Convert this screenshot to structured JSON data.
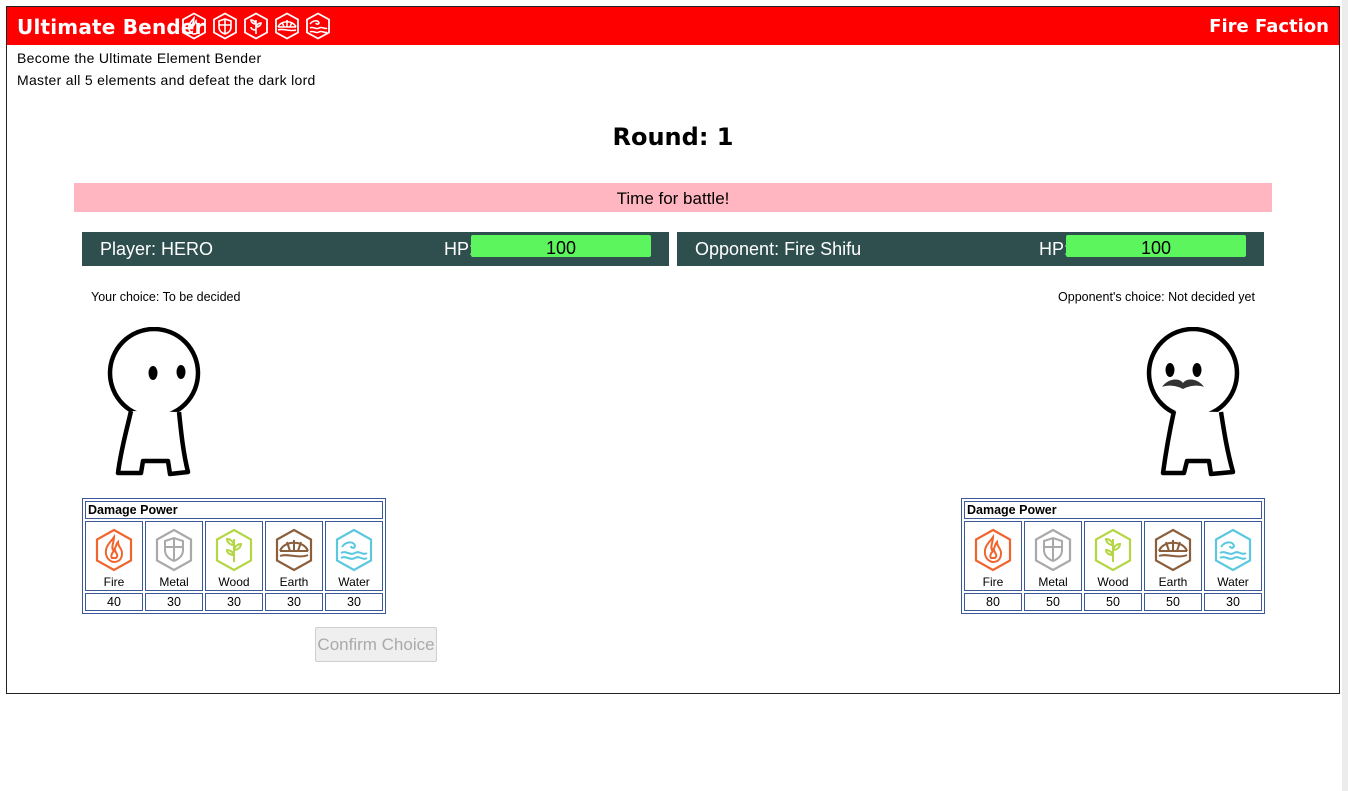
{
  "header": {
    "title": "Ultimate Bender",
    "faction": "Fire Faction",
    "icons": [
      "fire-icon",
      "metal-icon",
      "wood-icon",
      "earth-icon",
      "water-icon"
    ],
    "bg_color": "#ff0000"
  },
  "intro": {
    "line1": "Become the Ultimate Element Bender",
    "line2": "Master all 5 elements and defeat the dark lord"
  },
  "round_label": "Round: 1",
  "message": "Time for battle!",
  "player": {
    "label": "Player: HERO",
    "hp_label": "HP:",
    "hp": "100",
    "hp_fraction": 1.0,
    "choice": "Your choice: To be decided"
  },
  "opponent": {
    "label": "Opponent: Fire Shifu",
    "hp_label": "HP:",
    "hp": "100",
    "hp_fraction": 1.0,
    "choice": "Opponent's choice: Not decided yet"
  },
  "damage_table_title": "Damage Power",
  "elements": [
    {
      "name": "Fire",
      "icon": "fire-icon",
      "color": "#f0642d"
    },
    {
      "name": "Metal",
      "icon": "metal-icon",
      "color": "#a9a9a9"
    },
    {
      "name": "Wood",
      "icon": "wood-icon",
      "color": "#b5d644"
    },
    {
      "name": "Earth",
      "icon": "earth-icon",
      "color": "#8b5e3c"
    },
    {
      "name": "Water",
      "icon": "water-icon",
      "color": "#5bc8e0"
    }
  ],
  "player_damage": [
    "40",
    "30",
    "30",
    "30",
    "30"
  ],
  "opponent_damage": [
    "80",
    "50",
    "50",
    "50",
    "30"
  ],
  "confirm_label": "Confirm Choice",
  "colors": {
    "message_bg": "#ffb6c1",
    "statbar_bg": "#2f4f4f",
    "hp_bar": "#5df55d"
  }
}
